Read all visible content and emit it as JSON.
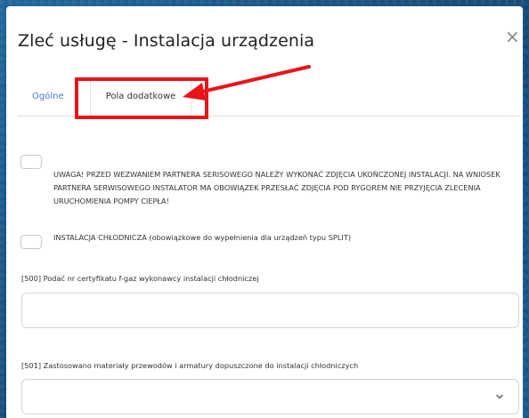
{
  "dialog": {
    "title": "Zleć usługę - Instalacja urządzenia",
    "close_glyph": "×"
  },
  "tabs": [
    {
      "label": "Ogólne",
      "active": false
    },
    {
      "label": "Pola dodatkowe",
      "active": true
    }
  ],
  "annotation": {
    "color": "#e8141a"
  },
  "form": {
    "checkbox_notice": {
      "checked": false,
      "text": "UWAGA! PRZED WEZWANIEM PARTNERA SERISOWEGO NALEŻY WYKONAĆ ZDJĘCIA UKOŃCZONEJ INSTALACJI. NA WNIOSEK PARTNERA SERWISOWEGO INSTALATOR MA OBOWIĄZEK PRZESŁAĆ ZDJĘCIA POD RYGOREM NIE PRZYJĘCIA ZLECENIA URUCHOMIENIA POMPY CIEPŁA!"
    },
    "checkbox_cooling": {
      "checked": false,
      "text": "INSTALACJA CHŁODNICZA (obowiązkowe do wypełnienia dla urządzeń typu SPLIT)"
    },
    "field_500": {
      "label": "[500] Podać nr certyfikatu f-gaz wykonawcy instalacji chłodniczej",
      "value": "",
      "placeholder": ""
    },
    "field_501": {
      "label": "[501] Zastosowano materiały przewodów i armatury dopuszczone do instalacji chłodniczych",
      "selected": ""
    }
  },
  "colors": {
    "tab_active_link": "#3f7dd6",
    "background": "#1d5a8c"
  },
  "icons": {
    "close": "close-icon",
    "chevron": "chevron-down-icon",
    "arrow": "red-arrow-annotation"
  }
}
